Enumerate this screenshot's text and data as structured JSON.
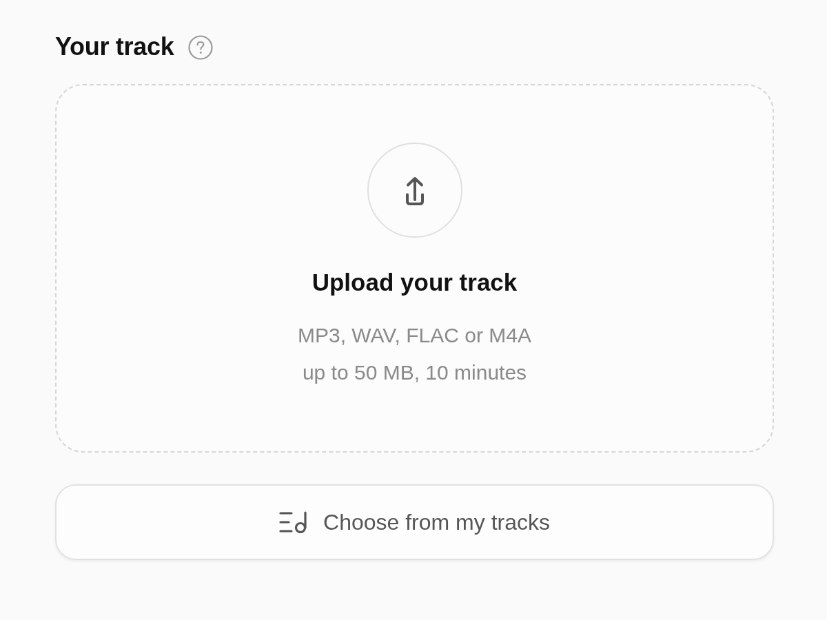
{
  "section": {
    "title": "Your track"
  },
  "dropzone": {
    "title": "Upload your track",
    "lines": [
      "MP3, WAV, FLAC or M4A",
      "up to 50 MB, 10 minutes"
    ]
  },
  "choose_button": {
    "label": "Choose from my tracks"
  }
}
